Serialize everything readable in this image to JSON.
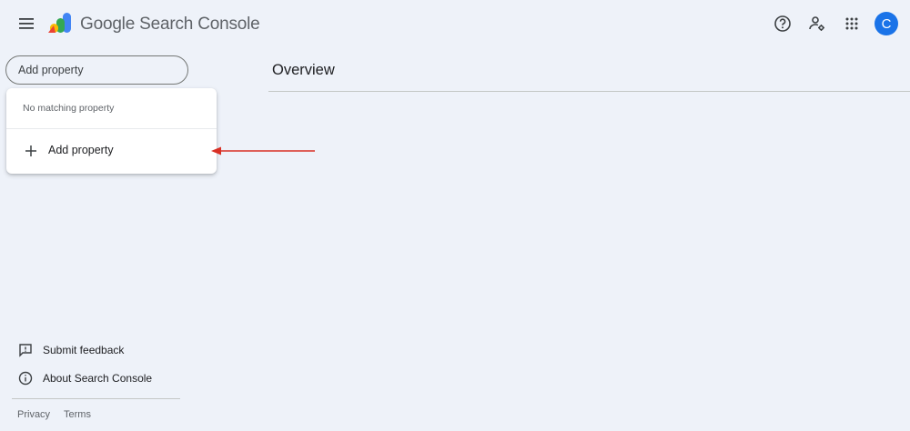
{
  "header": {
    "brand": "Google Search Console",
    "avatar_initial": "C",
    "icons": [
      "menu-icon",
      "help-icon",
      "admin-settings-icon",
      "apps-grid-icon"
    ]
  },
  "search": {
    "placeholder": "Add property"
  },
  "dropdown": {
    "empty_text": "No matching property",
    "add_label": "Add property"
  },
  "main": {
    "title": "Overview"
  },
  "sidebar": {
    "links": [
      {
        "label": "Submit feedback",
        "icon": "feedback-icon"
      },
      {
        "label": "About Search Console",
        "icon": "info-icon"
      }
    ]
  },
  "footer": {
    "privacy": "Privacy",
    "terms": "Terms"
  },
  "colors": {
    "background": "#eef2f9",
    "avatar": "#1a73e8",
    "annotation_arrow": "#d93025"
  }
}
